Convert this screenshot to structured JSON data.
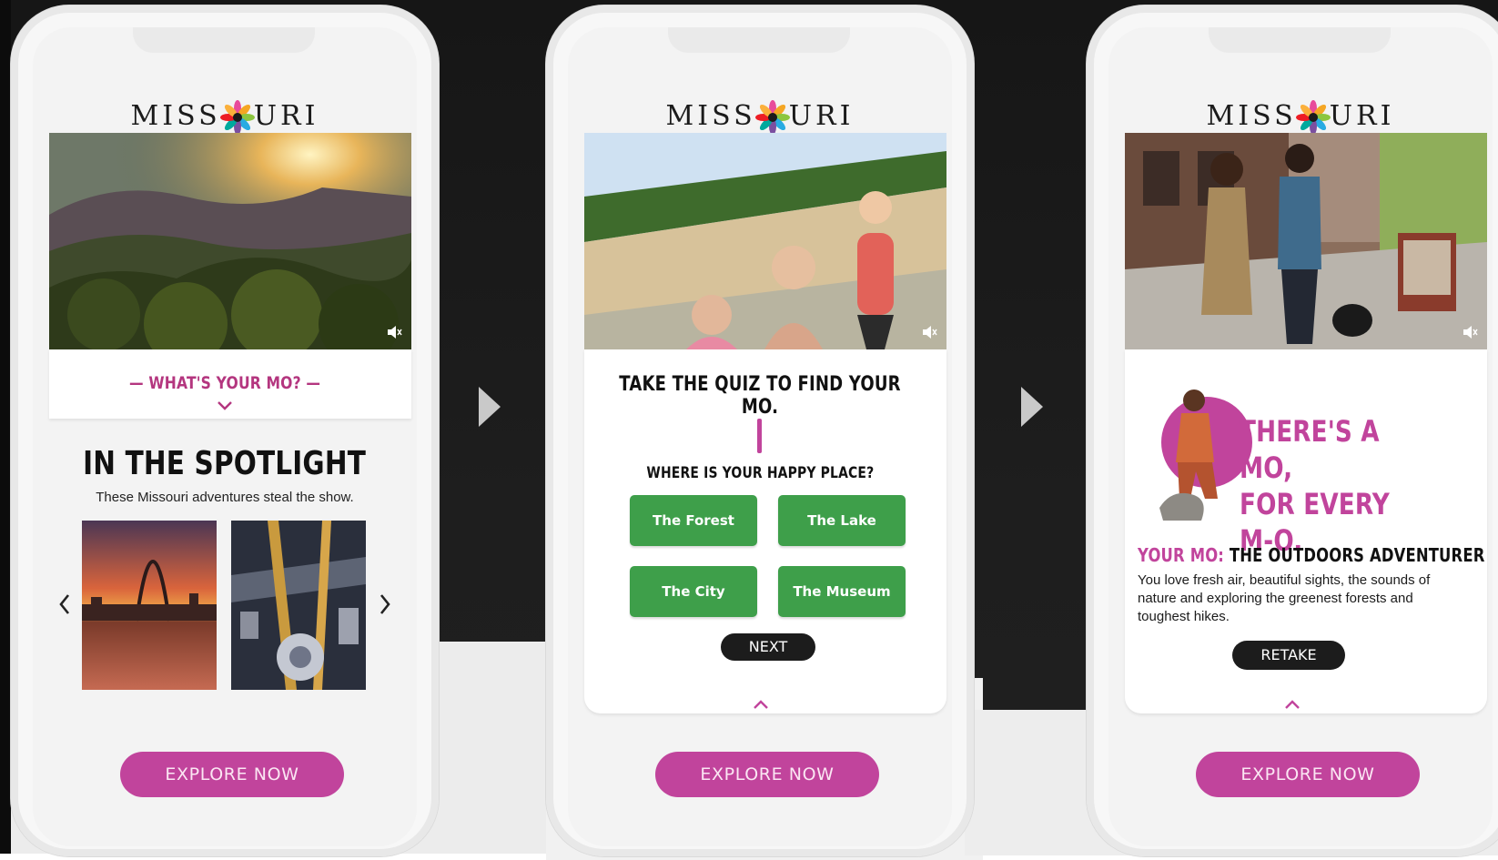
{
  "brand": {
    "name_left": "MISS",
    "name_right": "URI"
  },
  "screens": [
    {
      "prompt": "WHAT'S YOUR MO?",
      "spotlight_title": "IN THE SPOTLIGHT",
      "spotlight_subtitle": "These Missouri adventures steal the show.",
      "cta": "EXPLORE NOW"
    },
    {
      "quiz_title": "TAKE THE QUIZ TO FIND YOUR MO.",
      "question": "WHERE IS YOUR HAPPY PLACE?",
      "options": [
        "The Forest",
        "The Lake",
        "The City",
        "The Museum"
      ],
      "next": "NEXT",
      "cta": "EXPLORE NOW"
    },
    {
      "headline_line1": "THERE'S A MO,",
      "headline_line2": "FOR EVERY M-O.",
      "result_label": "YOUR MO:",
      "result_value": "THE OUTDOORS ADVENTURER",
      "result_body": "You love fresh air, beautiful sights, the sounds of nature and exploring the greenest forests and toughest hikes.",
      "retake": "RETAKE",
      "cta": "EXPLORE NOW"
    }
  ],
  "colors": {
    "accent": "#c1449c",
    "quiz_green": "#3e9f4a",
    "dark": "#1c1c1c"
  },
  "icons": [
    "missouri-flower-logo-icon",
    "mute-speaker-icon",
    "chevron-down-icon",
    "chevron-left-icon",
    "chevron-right-icon",
    "chevron-up-icon",
    "play-arrow-icon"
  ]
}
